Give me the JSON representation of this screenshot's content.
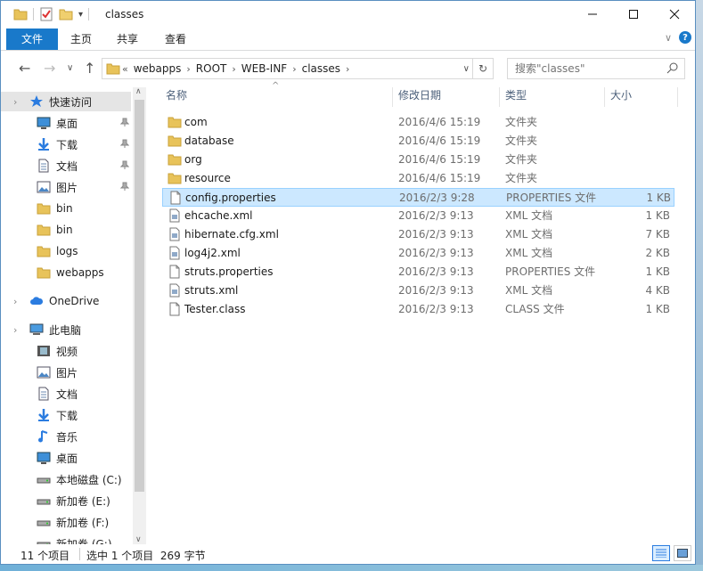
{
  "title": "classes",
  "ribbon": {
    "tabs": [
      "文件",
      "主页",
      "共享",
      "查看"
    ]
  },
  "address": {
    "crumbs": [
      "webapps",
      "ROOT",
      "WEB-INF",
      "classes"
    ],
    "prefix": "«"
  },
  "search": {
    "placeholder": "搜索\"classes\""
  },
  "sidebar": {
    "items": [
      {
        "label": "快速访问",
        "icon": "star-icon"
      },
      {
        "label": "桌面",
        "icon": "desktop-icon",
        "pinned": true
      },
      {
        "label": "下载",
        "icon": "download-icon",
        "pinned": true
      },
      {
        "label": "文档",
        "icon": "document-icon",
        "pinned": true
      },
      {
        "label": "图片",
        "icon": "pictures-icon",
        "pinned": true
      },
      {
        "label": "bin",
        "icon": "folder-icon"
      },
      {
        "label": "bin",
        "icon": "folder-icon"
      },
      {
        "label": "logs",
        "icon": "folder-icon"
      },
      {
        "label": "webapps",
        "icon": "folder-icon"
      },
      {
        "label": "OneDrive",
        "icon": "cloud-icon"
      },
      {
        "label": "此电脑",
        "icon": "computer-icon"
      },
      {
        "label": "视频",
        "icon": "video-icon"
      },
      {
        "label": "图片",
        "icon": "pictures-icon"
      },
      {
        "label": "文档",
        "icon": "document-icon"
      },
      {
        "label": "下载",
        "icon": "download-icon"
      },
      {
        "label": "音乐",
        "icon": "music-icon"
      },
      {
        "label": "桌面",
        "icon": "desktop-icon"
      },
      {
        "label": "本地磁盘 (C:)",
        "icon": "drive-icon"
      },
      {
        "label": "新加卷 (E:)",
        "icon": "drive-icon"
      },
      {
        "label": "新加卷 (F:)",
        "icon": "drive-icon"
      },
      {
        "label": "新加卷 (G:)",
        "icon": "drive-icon"
      }
    ]
  },
  "columns": {
    "name": "名称",
    "date": "修改日期",
    "type": "类型",
    "size": "大小"
  },
  "files": [
    {
      "name": "com",
      "date": "2016/4/6 15:19",
      "type": "文件夹",
      "size": "",
      "icon": "folder-icon"
    },
    {
      "name": "database",
      "date": "2016/4/6 15:19",
      "type": "文件夹",
      "size": "",
      "icon": "folder-icon"
    },
    {
      "name": "org",
      "date": "2016/4/6 15:19",
      "type": "文件夹",
      "size": "",
      "icon": "folder-icon"
    },
    {
      "name": "resource",
      "date": "2016/4/6 15:19",
      "type": "文件夹",
      "size": "",
      "icon": "folder-icon"
    },
    {
      "name": "config.properties",
      "date": "2016/2/3 9:28",
      "type": "PROPERTIES 文件",
      "size": "1 KB",
      "icon": "file-icon",
      "selected": true
    },
    {
      "name": "ehcache.xml",
      "date": "2016/2/3 9:13",
      "type": "XML 文档",
      "size": "1 KB",
      "icon": "xml-file-icon"
    },
    {
      "name": "hibernate.cfg.xml",
      "date": "2016/2/3 9:13",
      "type": "XML 文档",
      "size": "7 KB",
      "icon": "xml-file-icon"
    },
    {
      "name": "log4j2.xml",
      "date": "2016/2/3 9:13",
      "type": "XML 文档",
      "size": "2 KB",
      "icon": "xml-file-icon"
    },
    {
      "name": "struts.properties",
      "date": "2016/2/3 9:13",
      "type": "PROPERTIES 文件",
      "size": "1 KB",
      "icon": "file-icon"
    },
    {
      "name": "struts.xml",
      "date": "2016/2/3 9:13",
      "type": "XML 文档",
      "size": "4 KB",
      "icon": "xml-file-icon"
    },
    {
      "name": "Tester.class",
      "date": "2016/2/3 9:13",
      "type": "CLASS 文件",
      "size": "1 KB",
      "icon": "file-icon"
    }
  ],
  "status": {
    "count": "11 个项目",
    "selection": "选中 1 个项目  269 字节"
  },
  "colors": {
    "accent": "#1979ca",
    "selection": "#cce8ff",
    "folder": "#e8c35a"
  }
}
